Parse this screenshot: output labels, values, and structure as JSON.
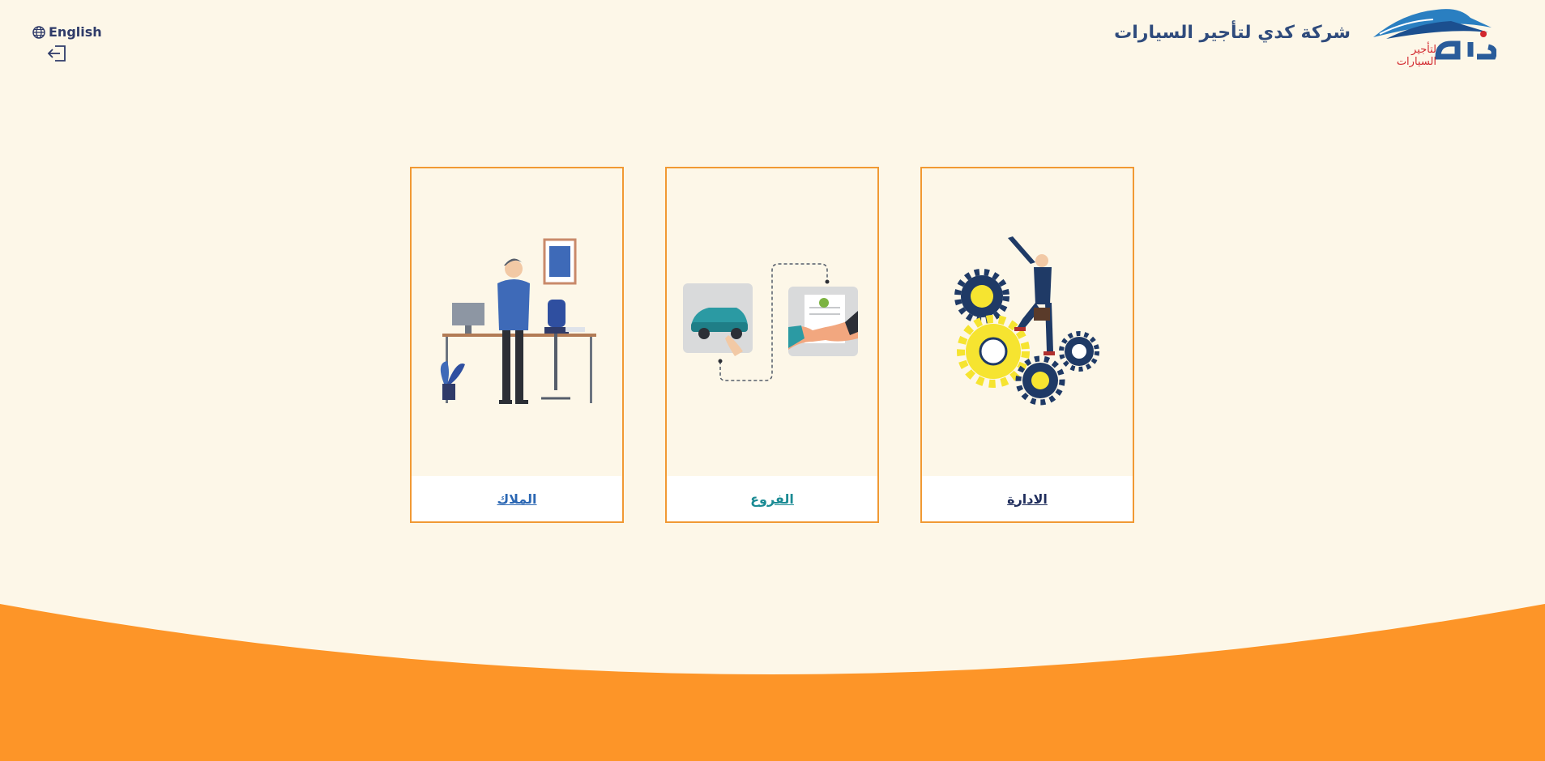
{
  "header": {
    "company_name": "شركة كدي لتأجير السيارات",
    "logo_tagline": "لتأجير السيارات"
  },
  "top_left": {
    "language_label": "English"
  },
  "cards": [
    {
      "label": "الملاك",
      "label_color": "#2a66b3"
    },
    {
      "label": "الفروع",
      "label_color": "#1b8b94"
    },
    {
      "label": "الادارة",
      "label_color": "#1f2d5c"
    }
  ],
  "colors": {
    "background": "#fdf7e8",
    "accent": "#f19933",
    "wave": "#fd9528",
    "brand_blue": "#2f4b7c",
    "brand_red": "#d2282e"
  }
}
